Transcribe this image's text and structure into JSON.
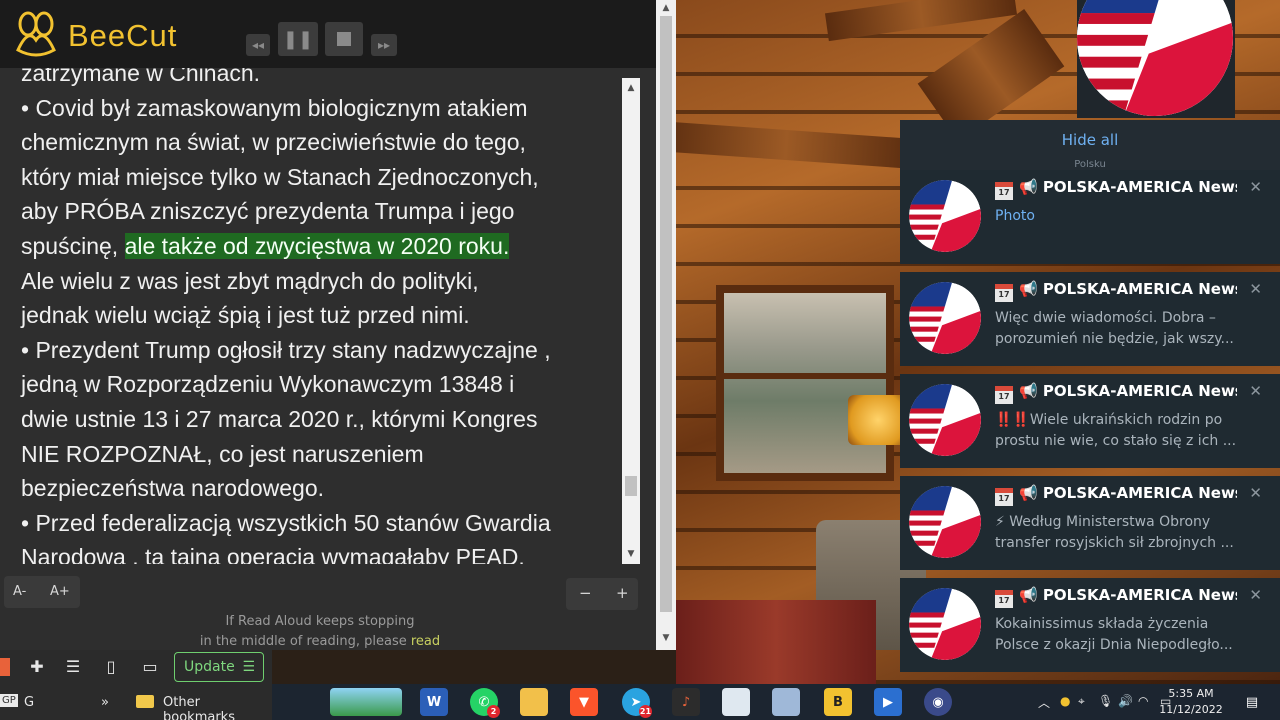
{
  "app": {
    "logo_text": "BeeCut"
  },
  "reader": {
    "lines": [
      "zatrzymane w Chinach.",
      "• Covid był zamaskowanym biologicznym atakiem",
      "chemicznym na świat, w przeciwieństwie do tego,",
      "który miał miejsce tylko w Stanach Zjednoczonych,",
      "aby PRÓBA zniszczyć prezydenta Trumpa i jego",
      "Ale wielu z was jest zbyt mądrych do polityki,",
      "jednak wielu wciąż śpią i jest tuż przed nimi.",
      "• Prezydent Trump ogłosił trzy stany nadzwyczajne ,",
      "jedną w Rozporządzeniu Wykonawczym 13848 i",
      "dwie ustnie 13 i 27 marca 2020 r., którymi Kongres",
      "NIE ROZPOZNAŁ, co jest naruszeniem",
      "bezpieczeństwa narodowego.",
      "• Przed federalizacją wszystkich 50 stanów Gwardia",
      "Narodowa , ta tajna operacja wymagałaby PEAD."
    ],
    "line6_prefix": "spuścinę, ",
    "line6_highlight": "ale także od zwycięstwa w 2020 roku.",
    "font_decrease": "A-",
    "font_increase": "A+",
    "zoom_out": "−",
    "zoom_in": "+",
    "hint_line1": "If Read Aloud keeps stopping",
    "hint_line2_prefix": "in the middle of reading, please ",
    "hint_link": "read"
  },
  "browser": {
    "update_label": "Update",
    "bookmarks": {
      "left_item": "G",
      "overflow": "»",
      "other": "Other bookmarks",
      "gp_label": "GP"
    }
  },
  "notifications": {
    "hide_all": "Hide all",
    "ghost_text": "Polsku",
    "items": [
      {
        "title": "📢 POLSKA-AMERICA News ...",
        "body1": "Photo",
        "body2": "",
        "is_link": true
      },
      {
        "title": "📢 POLSKA-AMERICA News ...",
        "body1": "Więc dwie wiadomości. Dobra –",
        "body2": "porozumień nie będzie, jak wszy...",
        "is_link": false
      },
      {
        "title": "📢 POLSKA-AMERICA News ...",
        "body1": "‼️‼️Wiele ukraińskich rodzin po",
        "body2": "prostu nie wie, co stało się z ich ...",
        "is_link": false
      },
      {
        "title": "📢 POLSKA-AMERICA News ...",
        "body1": "⚡ Według Ministerstwa Obrony",
        "body2": "transfer rosyjskich sił zbrojnych ...",
        "is_link": false
      },
      {
        "title": "📢 POLSKA-AMERICA News ...",
        "body1": "Kokainissimus składa życzenia",
        "body2": "Polsce z okazji Dnia Niepodległo...",
        "is_link": false
      }
    ],
    "calendar_day": "17"
  },
  "taskbar": {
    "whatsapp_badge": "2",
    "telegram_badge": "21",
    "clock_time": "5:35 AM",
    "clock_date": "11/12/2022"
  },
  "colors": {
    "beecut_accent": "#f2c230",
    "highlight": "#1f6a21",
    "notification_bg": "#1f2a31",
    "link_blue": "#6fb1f2",
    "update_green": "#7fd87f"
  }
}
